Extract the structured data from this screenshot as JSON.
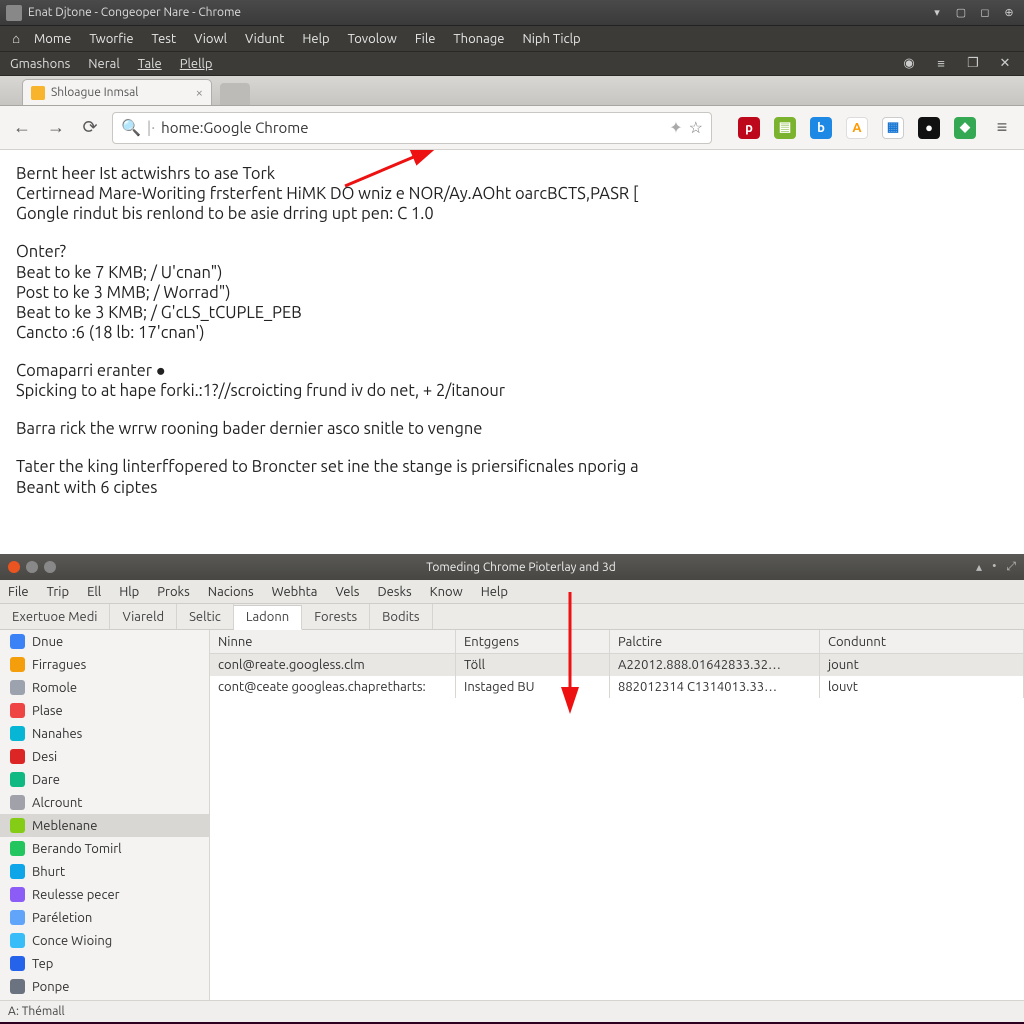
{
  "desktop": {
    "title": "Enat Djtone - Congeoper Nare - Chrome"
  },
  "menu1": {
    "items": [
      "Mome",
      "Tworfie",
      "Test",
      "Viowl",
      "Vidunt",
      "Help",
      "Tovolow",
      "File",
      "Thonage",
      "Niph Ticlp"
    ]
  },
  "menu2": {
    "left": [
      "Gmashons",
      "Neral",
      "Tale",
      "Plellp"
    ]
  },
  "tab": {
    "title": "Shloague Inmsal"
  },
  "address": {
    "value": "home:Google Chrome"
  },
  "page_lines": {
    "l0": "Bernt heer Ist actwishrs to ase Tork",
    "l1": "Certirnead Mare-Woriting frsterfent HiMK DO wniz e NOR/Ay.AOht oarcBCTS,PASR [",
    "l2": "Gongle rindut bis renlond to be asie drring upt pen: C 1.0",
    "l3": "Onter?",
    "l4": "Beat to ke 7 KMB; / U'cnan\")",
    "l5": "Post to ke 3 MMB; / Worrad\")",
    "l6": "Beat to ke 3 KMB; / G'cLS_tCUPLE_PEB",
    "l7": "Cancto :6 (18 lb:  17'cnan')",
    "l8": "Comaparri eranter ●",
    "l9": "Spicking to at hape forki.:1?//scroicting frund iv do net, + 2/itanour",
    "l10": "Barra rick the wrrw rooning bader dernier asco snitle to vengne",
    "l11": "Tater the king linterffopered to Broncter set ine the stange is priersificnales nporig a",
    "l12": "Beant with 6 ciptes"
  },
  "win2": {
    "title": "Tomeding Chrome Pioterlay and 3d",
    "menu": [
      "File",
      "Trip",
      "Ell",
      "Hlp",
      "Proks",
      "Nacions",
      "Webhta",
      "Vels",
      "Desks",
      "Know",
      "Help"
    ],
    "tabs": [
      "Exertuoe Medi",
      "Viareld",
      "Seltic",
      "Ladonn",
      "Forests",
      "Bodits"
    ],
    "active_tab": 3,
    "columns": [
      "Ninne",
      "Entggens",
      "Palctire",
      "Condunnt"
    ],
    "rows": [
      {
        "c1": "conl@reate.googless.clm",
        "c2": "Töll",
        "c3": "A22012.888.01642833.32…",
        "c4": "jount"
      },
      {
        "c1": "cont@ceate googleas.chapretharts:",
        "c2": "Instaged BU",
        "c3": "882012314 C1314013.33…",
        "c4": "louvt"
      }
    ],
    "sidebar": [
      {
        "label": "Dnue",
        "color": "#3b82f6"
      },
      {
        "label": "Firragues",
        "color": "#f59e0b"
      },
      {
        "label": "Romole",
        "color": "#9ca3af"
      },
      {
        "label": "Plase",
        "color": "#ef4444"
      },
      {
        "label": "Nanahes",
        "color": "#06b6d4"
      },
      {
        "label": "Desi",
        "color": "#dc2626"
      },
      {
        "label": "Dare",
        "color": "#10b981"
      },
      {
        "label": "Alcrount",
        "color": "#a1a1aa"
      },
      {
        "label": "Meblenane",
        "color": "#84cc16",
        "selected": true
      },
      {
        "label": "Berando Tomirl",
        "color": "#22c55e"
      },
      {
        "label": "Bhurt",
        "color": "#0ea5e9"
      },
      {
        "label": "Reulesse pecer",
        "color": "#8b5cf6"
      },
      {
        "label": "Paréletion",
        "color": "#60a5fa"
      },
      {
        "label": "Conce Wioing",
        "color": "#38bdf8"
      },
      {
        "label": "Tep",
        "color": "#2563eb"
      },
      {
        "label": "Ponpe",
        "color": "#6b7280"
      }
    ],
    "status": "A: Thémall"
  },
  "ext_colors": {
    "pinterest": "#bd081c",
    "ever": "#7bb32e",
    "box": "#1e88e5",
    "amz": "#ff9900",
    "cal": "#1976d2",
    "dark": "#111",
    "map": "#34a853"
  }
}
